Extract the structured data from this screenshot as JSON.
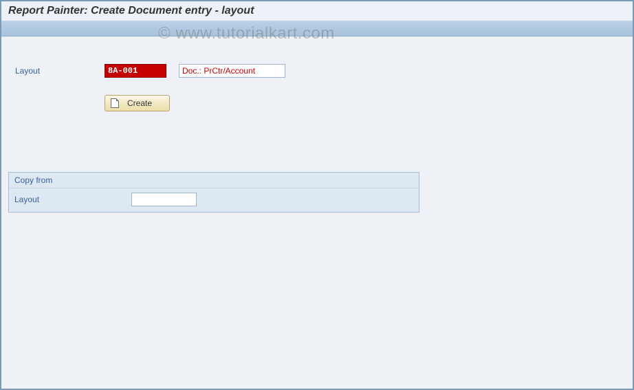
{
  "header": {
    "title": "Report Painter: Create Document entry - layout"
  },
  "form": {
    "layout_label": "Layout",
    "layout_code": "8A-001",
    "layout_desc": "Doc.: PrCtr/Account",
    "create_label": "Create"
  },
  "copy_panel": {
    "heading": "Copy from",
    "layout_label": "Layout",
    "layout_value": ""
  },
  "watermark": "© www.tutorialkart.com"
}
